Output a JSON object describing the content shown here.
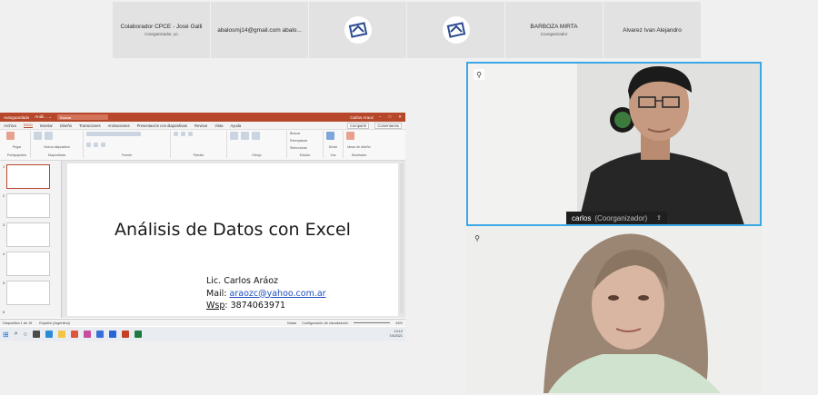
{
  "participants_strip": [
    {
      "name": "Colaborador CPCE - José Galli",
      "role": "Coorganizador, yo",
      "type": "text"
    },
    {
      "name": "abalosmj14@gmail.com abalo...",
      "role": "",
      "type": "text"
    },
    {
      "name": "",
      "role": "",
      "type": "logo"
    },
    {
      "name": "",
      "role": "",
      "type": "logo"
    },
    {
      "name": "BARBOZA MIRTA",
      "role": "Coorganizador",
      "type": "text"
    },
    {
      "name": "Alvarez Ivan Alejandro",
      "role": "",
      "type": "text"
    }
  ],
  "ppt": {
    "autosave": "Autoguardado",
    "filename": "Análi... ⌄",
    "search": "Buscar",
    "user": "Carlos Araoz",
    "tabs": [
      "Archivo",
      "Inicio",
      "Insertar",
      "Diseño",
      "Transiciones",
      "Animaciones",
      "Presentación con diapositivas",
      "Revisar",
      "Vista",
      "Ayuda"
    ],
    "active_tab": "Inicio",
    "share_label": "Compartir",
    "comments_label": "Comentarios",
    "ribbon_groups": [
      "Portapapeles",
      "Diapositivas",
      "Fuente",
      "Párrafo",
      "Dibujo",
      "Edición",
      "Voz",
      "Diseñador"
    ],
    "ribbon_buttons": [
      "Pegar",
      "Nueva diapositiva",
      "Buscar",
      "Reemplazar",
      "Seleccionar",
      "Dictar",
      "Ideas de diseño"
    ],
    "thumb_numbers": [
      "1",
      "2",
      "3",
      "4",
      "5",
      "6"
    ],
    "slide": {
      "title": "Análisis de Datos con Excel",
      "line1": "Lic. Carlos Aráoz",
      "mail_label": "Mail: ",
      "mail_value": "araozc@yahoo.com.ar",
      "wsp_label": "Wsp",
      "wsp_value": ": 3874063971"
    },
    "status_left": "Diapositiva 1 de 15",
    "status_lang": "Español (Argentina)",
    "status_notes": "Notas",
    "status_config": "Configuración de visualización",
    "zoom": "46%",
    "clock_time": "13:12",
    "clock_date": "7/4/2021"
  },
  "videos": [
    {
      "name": "carlos",
      "role": "(Coorganizador)",
      "active_speaker": true
    },
    {
      "name": "",
      "role": "",
      "active_speaker": false
    }
  ],
  "colors": {
    "accent": "#b7472a",
    "active_border": "#3aa8e6"
  }
}
